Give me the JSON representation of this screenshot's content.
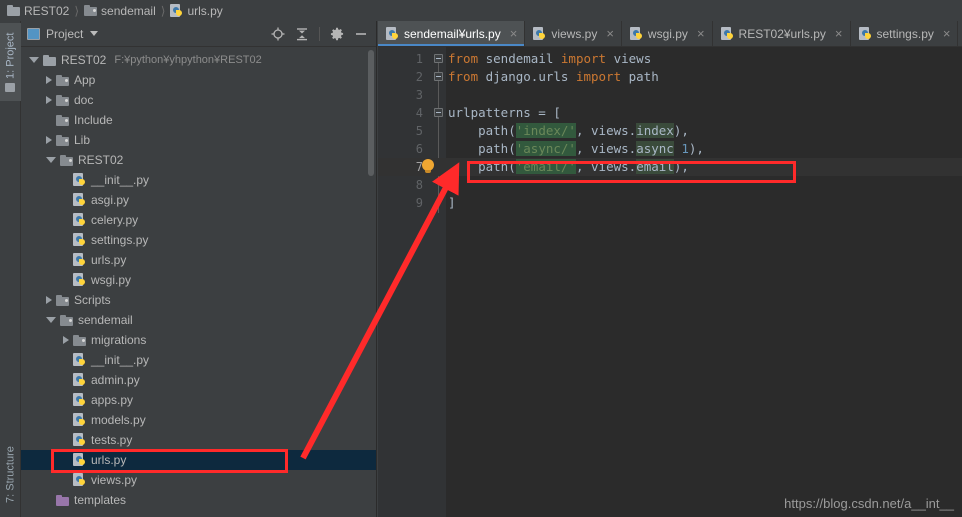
{
  "ide": {
    "theme_bg": "#3c3f41",
    "editor_bg": "#2b2b2b",
    "accent": "#4a88c7",
    "annotation_color": "#ff2a2a"
  },
  "breadcrumb": [
    {
      "label": "REST02",
      "icon": "folder-icon"
    },
    {
      "label": "sendemail",
      "icon": "folder-dark-icon"
    },
    {
      "label": "urls.py",
      "icon": "python-file-icon"
    }
  ],
  "rail": {
    "top": {
      "label": "1: Project",
      "icon": "folder-icon"
    },
    "bottom": {
      "label": "7: Structure"
    }
  },
  "project_panel": {
    "title": "Project",
    "tools": [
      {
        "name": "locate-icon"
      },
      {
        "name": "collapse-all-icon"
      },
      {
        "name": "settings-gear-icon"
      },
      {
        "name": "hide-panel-icon"
      }
    ],
    "tree": [
      {
        "indent": 0,
        "twisty": "down",
        "icon": "folder-icon",
        "label": "REST02",
        "path": "F:¥python¥yhpython¥REST02",
        "selected": false
      },
      {
        "indent": 1,
        "twisty": "right",
        "icon": "folder-dark-icon",
        "label": "App",
        "selected": false
      },
      {
        "indent": 1,
        "twisty": "right",
        "icon": "folder-dark-icon",
        "label": "doc",
        "selected": false
      },
      {
        "indent": 1,
        "twisty": "none",
        "icon": "folder-dark-icon",
        "label": "Include",
        "selected": false
      },
      {
        "indent": 1,
        "twisty": "right",
        "icon": "folder-dark-icon",
        "label": "Lib",
        "selected": false
      },
      {
        "indent": 1,
        "twisty": "down",
        "icon": "folder-dark-icon",
        "label": "REST02",
        "selected": false
      },
      {
        "indent": 2,
        "twisty": "none",
        "icon": "python-file-icon",
        "label": "__init__.py",
        "selected": false
      },
      {
        "indent": 2,
        "twisty": "none",
        "icon": "python-file-icon",
        "label": "asgi.py",
        "selected": false
      },
      {
        "indent": 2,
        "twisty": "none",
        "icon": "python-file-icon",
        "label": "celery.py",
        "selected": false
      },
      {
        "indent": 2,
        "twisty": "none",
        "icon": "python-file-icon",
        "label": "settings.py",
        "selected": false
      },
      {
        "indent": 2,
        "twisty": "none",
        "icon": "python-file-icon",
        "label": "urls.py",
        "selected": false
      },
      {
        "indent": 2,
        "twisty": "none",
        "icon": "python-file-icon",
        "label": "wsgi.py",
        "selected": false
      },
      {
        "indent": 1,
        "twisty": "right",
        "icon": "folder-dark-icon",
        "label": "Scripts",
        "selected": false
      },
      {
        "indent": 1,
        "twisty": "down",
        "icon": "folder-dark-icon",
        "label": "sendemail",
        "selected": false
      },
      {
        "indent": 2,
        "twisty": "right",
        "icon": "folder-dark-icon",
        "label": "migrations",
        "selected": false
      },
      {
        "indent": 2,
        "twisty": "none",
        "icon": "python-file-icon",
        "label": "__init__.py",
        "selected": false
      },
      {
        "indent": 2,
        "twisty": "none",
        "icon": "python-file-icon",
        "label": "admin.py",
        "selected": false
      },
      {
        "indent": 2,
        "twisty": "none",
        "icon": "python-file-icon",
        "label": "apps.py",
        "selected": false
      },
      {
        "indent": 2,
        "twisty": "none",
        "icon": "python-file-icon",
        "label": "models.py",
        "selected": false
      },
      {
        "indent": 2,
        "twisty": "none",
        "icon": "python-file-icon",
        "label": "tests.py",
        "selected": false
      },
      {
        "indent": 2,
        "twisty": "none",
        "icon": "python-file-icon",
        "label": "urls.py",
        "selected": true
      },
      {
        "indent": 2,
        "twisty": "none",
        "icon": "python-file-icon",
        "label": "views.py",
        "selected": false
      },
      {
        "indent": 1,
        "twisty": "none",
        "icon": "folder-purple-icon",
        "label": "templates",
        "selected": false
      }
    ]
  },
  "editor": {
    "tabs": [
      {
        "label": "sendemail¥urls.py",
        "active": true,
        "close": "×"
      },
      {
        "label": "views.py",
        "active": false,
        "close": "×"
      },
      {
        "label": "wsgi.py",
        "active": false,
        "close": "×"
      },
      {
        "label": "REST02¥urls.py",
        "active": false,
        "close": "×"
      },
      {
        "label": "settings.py",
        "active": false,
        "close": "×"
      }
    ],
    "current_line": 7,
    "lines": [
      {
        "n": "1",
        "text": "from sendemail import views"
      },
      {
        "n": "2",
        "text": "from django.urls import path"
      },
      {
        "n": "3",
        "text": ""
      },
      {
        "n": "4",
        "text": "urlpatterns = ["
      },
      {
        "n": "5",
        "text": "    path('index/', views.index),"
      },
      {
        "n": "6",
        "text": "    path('async/', views.async 1),"
      },
      {
        "n": "7",
        "text": "    path('email/', views.email),"
      },
      {
        "n": "8",
        "text": ""
      },
      {
        "n": "9",
        "text": "]"
      }
    ],
    "gutter_icon": "lightbulb-intention-icon",
    "watermark": "https://blog.csdn.net/a__int__"
  },
  "annotations": [
    {
      "name": "code-line-highlight",
      "target": "path('email/', views.email),"
    },
    {
      "name": "tree-file-highlight",
      "target": "urls.py"
    },
    {
      "name": "pointer-arrow",
      "from": "tree-file-highlight",
      "to": "lightbulb-intention-icon"
    }
  ]
}
